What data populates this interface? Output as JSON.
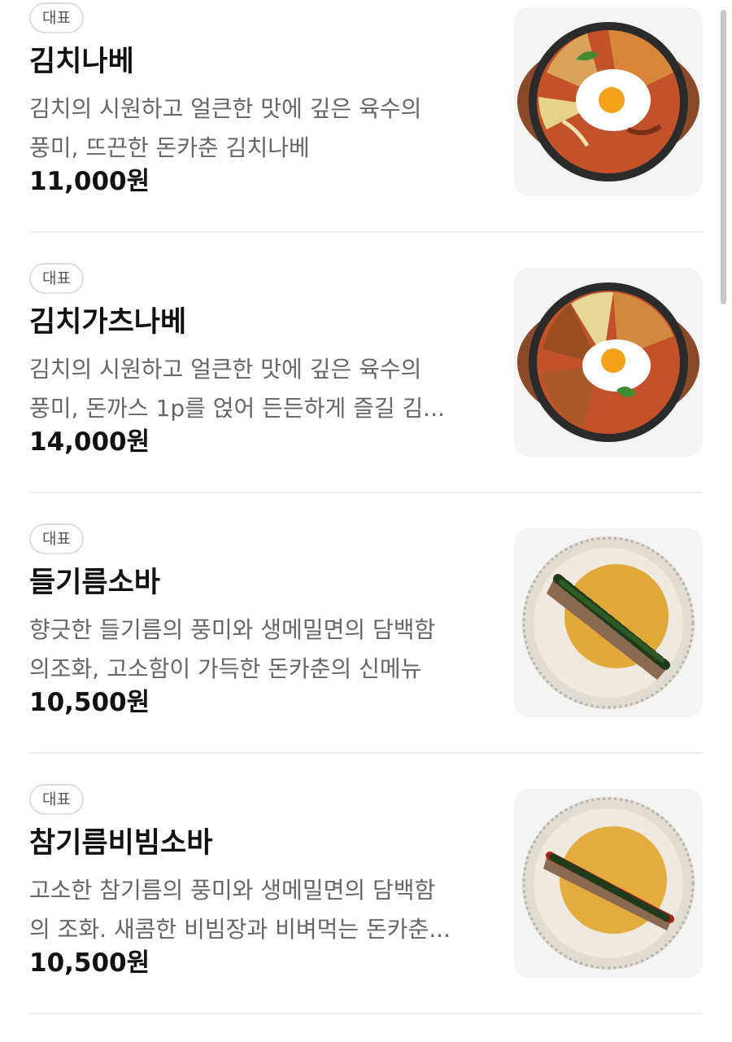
{
  "menu": {
    "items": [
      {
        "badge": "대표",
        "name": "김치나베",
        "desc_line1": "김치의 시원하고 얼큰한 맛에 깊은 육수의",
        "desc_line2": "풍미, 뜨끈한 돈카춘 김치나베",
        "price": "11,000원",
        "image_icon": "kimchi-nabe-dish-image"
      },
      {
        "badge": "대표",
        "name": "김치가츠나베",
        "desc_line1": "김치의 시원하고 얼큰한 맛에 깊은 육수의",
        "desc_line2": "풍미, 돈까스 1p를 얹어 든든하게 즐길 김...",
        "price": "14,000원",
        "image_icon": "kimchi-katsu-nabe-dish-image"
      },
      {
        "badge": "대표",
        "name": "들기름소바",
        "desc_line1": "향긋한 들기름의 풍미와 생메밀면의 담백함",
        "desc_line2": "의조화, 고소함이 가득한 돈카춘의 신메뉴",
        "price": "10,500원",
        "image_icon": "perilla-oil-soba-dish-image"
      },
      {
        "badge": "대표",
        "name": "참기름비빔소바",
        "desc_line1": "고소한 참기름의 풍미와 생메밀면의 담백함",
        "desc_line2": "의 조화. 새콤한 비빔장과 비벼먹는 돈카춘...",
        "price": "10,500원",
        "image_icon": "sesame-oil-bibim-soba-dish-image"
      }
    ]
  },
  "colors": {
    "background": "#ffffff",
    "text_primary": "#111111",
    "text_secondary": "#666666",
    "badge_border": "#dedede",
    "divider": "#eeeeee",
    "thumb_bg": "#f4f4f4",
    "scrollbar": "#c6c6c6"
  }
}
